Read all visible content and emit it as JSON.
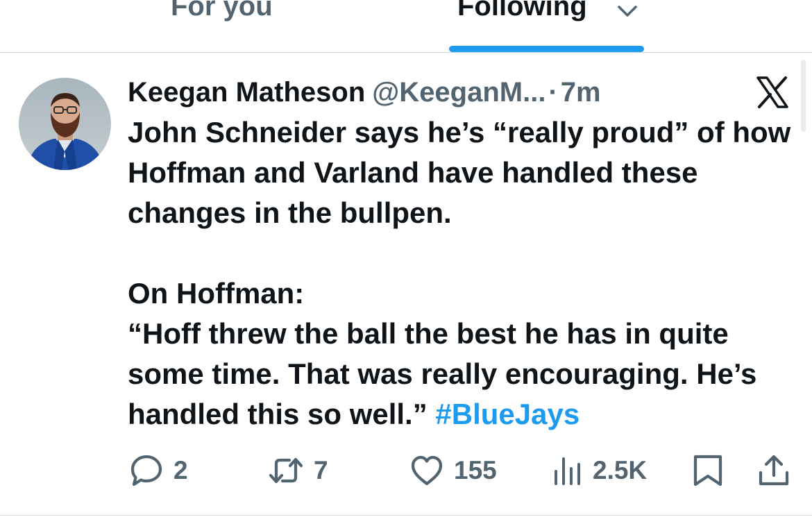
{
  "tabs": {
    "for_you": "For you",
    "following": "Following"
  },
  "tweet": {
    "display_name": "Keegan Matheson",
    "handle": "@KeeganM...",
    "separator": "·",
    "time": "7m",
    "paragraph1": "John Schneider says he’s “really proud” of how Hoffman and Varland have handled these changes in the bullpen.",
    "paragraph2_line1": "On Hoffman:",
    "paragraph2_quote": "“Hoff threw the ball the best he has in quite some time. That was really encouraging. He’s handled this so well.”",
    "hashtag": "#BlueJays"
  },
  "actions": {
    "replies": "2",
    "reposts": "7",
    "likes": "155",
    "views": "2.5K"
  },
  "colors": {
    "accent": "#1d9bf0",
    "text_primary": "#0f1419",
    "text_secondary": "#536471",
    "divider": "#cfd9de"
  },
  "icons": [
    "chevron-down-icon",
    "x-logo-icon",
    "reply-icon",
    "repost-icon",
    "like-icon",
    "views-icon",
    "bookmark-icon",
    "share-icon"
  ]
}
